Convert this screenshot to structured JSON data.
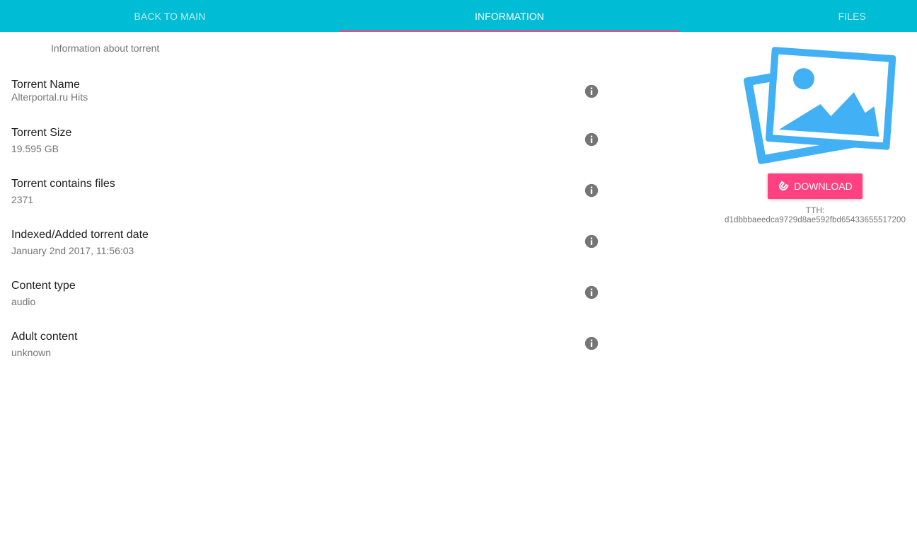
{
  "tabs": [
    {
      "label": "BACK TO MAIN"
    },
    {
      "label": "INFORMATION"
    },
    {
      "label": "FILES"
    }
  ],
  "subheader": "Information about torrent",
  "fields": [
    {
      "label": "Torrent Name",
      "value": "Alterportal.ru Hits"
    },
    {
      "label": "Torrent Size",
      "value": "19.595 GB"
    },
    {
      "label": "Torrent contains files",
      "value": "2371"
    },
    {
      "label": "Indexed/Added torrent date",
      "value": "January 2nd 2017, 11:56:03"
    },
    {
      "label": "Content type",
      "value": "audio"
    },
    {
      "label": "Adult content",
      "value": "unknown"
    }
  ],
  "side": {
    "download_label": "DOWNLOAD",
    "tth_label": "TTH:",
    "tth_hash": "d1dbbbaeedca9729d8ae592fbd65433655517200"
  },
  "colors": {
    "tabbar": "#00bcd4",
    "accent": "#ff4081",
    "poster": "#42b0f5",
    "info_icon": "#757575"
  },
  "icons": {
    "info": "info-icon",
    "poster": "image-placeholder-icon",
    "magnet": "magnet-icon"
  }
}
